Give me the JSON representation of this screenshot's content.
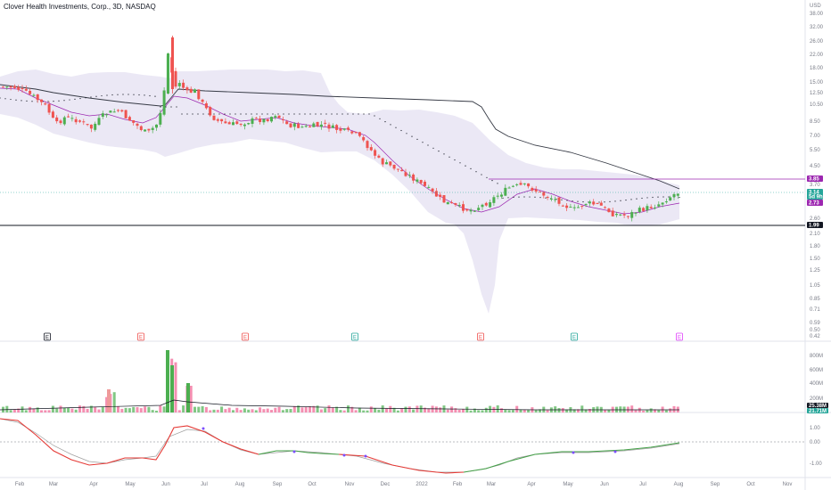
{
  "header": {
    "title": "Clover Health Investments, Corp., 3D, NASDAQ"
  },
  "price_axis": {
    "currency": "USD",
    "ticks": [
      "38.00",
      "32.00",
      "26.00",
      "22.00",
      "18.00",
      "15.00",
      "12.50",
      "10.50",
      "8.50",
      "7.00",
      "5.50",
      "4.50",
      "3.70",
      "3.20",
      "2.60",
      "2.10",
      "1.80",
      "1.50",
      "1.25",
      "1.05",
      "0.85",
      "0.71",
      "0.59",
      "0.50",
      "0.42"
    ]
  },
  "price_tags": [
    {
      "text": "3.85",
      "color": "#9c27b0"
    },
    {
      "text": "3.14",
      "sub": "5d 9h",
      "color": "#26a69a"
    },
    {
      "text": "2.73",
      "color": "#9c27b0"
    },
    {
      "text": "1.99",
      "color": "#131722"
    }
  ],
  "volume_axis": {
    "ticks": [
      "800M",
      "600M",
      "400M",
      "200M"
    ],
    "tags": [
      {
        "text": "25.38M",
        "color": "#131722"
      },
      {
        "text": "21.71M",
        "color": "#26a69a"
      }
    ]
  },
  "osc_axis": {
    "ticks": [
      "1.00",
      "0.00",
      "-1.00"
    ]
  },
  "time_axis": [
    "Feb",
    "Mar",
    "Apr",
    "May",
    "Jun",
    "Jul",
    "Aug",
    "Sep",
    "Oct",
    "Nov",
    "Dec",
    "2022",
    "Feb",
    "Mar",
    "Apr",
    "May",
    "Jun",
    "Jul",
    "Aug",
    "Sep",
    "Oct",
    "Nov"
  ],
  "events": [
    {
      "label": "E",
      "kind": "neutral"
    },
    {
      "label": "E",
      "kind": "negative"
    },
    {
      "label": "E",
      "kind": "negative"
    },
    {
      "label": "E",
      "kind": "positive"
    },
    {
      "label": "E",
      "kind": "negative"
    },
    {
      "label": "E",
      "kind": "positive"
    },
    {
      "label": "E",
      "kind": "upcoming"
    }
  ],
  "colors": {
    "up": "#26a69a",
    "up_fill": "#4caf50",
    "down": "#ef5350",
    "band": "#e8e4f3",
    "ma_long": "#363a45",
    "ma_short": "#9c27b0",
    "osc_main": "#e53935",
    "osc_up": "#43a047",
    "osc_signal": "#9e9e9e"
  }
}
